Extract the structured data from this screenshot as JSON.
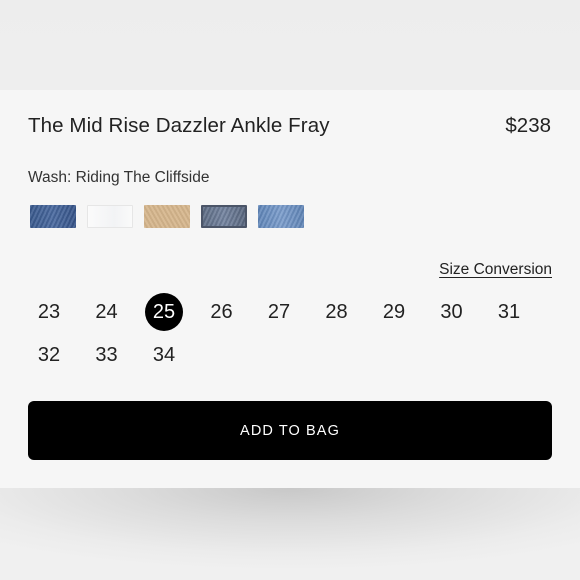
{
  "product": {
    "title": "The Mid Rise Dazzler Ankle Fray",
    "price": "$238"
  },
  "wash": {
    "label": "Wash: Riding The Cliffside",
    "swatches": [
      {
        "name": "dark-blue-denim",
        "color": "#3f5f93"
      },
      {
        "name": "white-denim",
        "color": "#f6f6f7"
      },
      {
        "name": "tan-denim",
        "color": "#d6b68d"
      },
      {
        "name": "grey-blue-denim",
        "color": "#6b7a94",
        "selected": true
      },
      {
        "name": "light-blue-denim",
        "color": "#6f92c2"
      }
    ]
  },
  "size_conversion_label": "Size Conversion",
  "sizes": [
    "23",
    "24",
    "25",
    "26",
    "27",
    "28",
    "29",
    "30",
    "31",
    "32",
    "33",
    "34"
  ],
  "selected_size": "25",
  "add_to_bag_label": "ADD TO BAG",
  "colors": {
    "button": "#000000",
    "selected_size_bg": "#000000",
    "card_bg": "#f6f6f6"
  }
}
